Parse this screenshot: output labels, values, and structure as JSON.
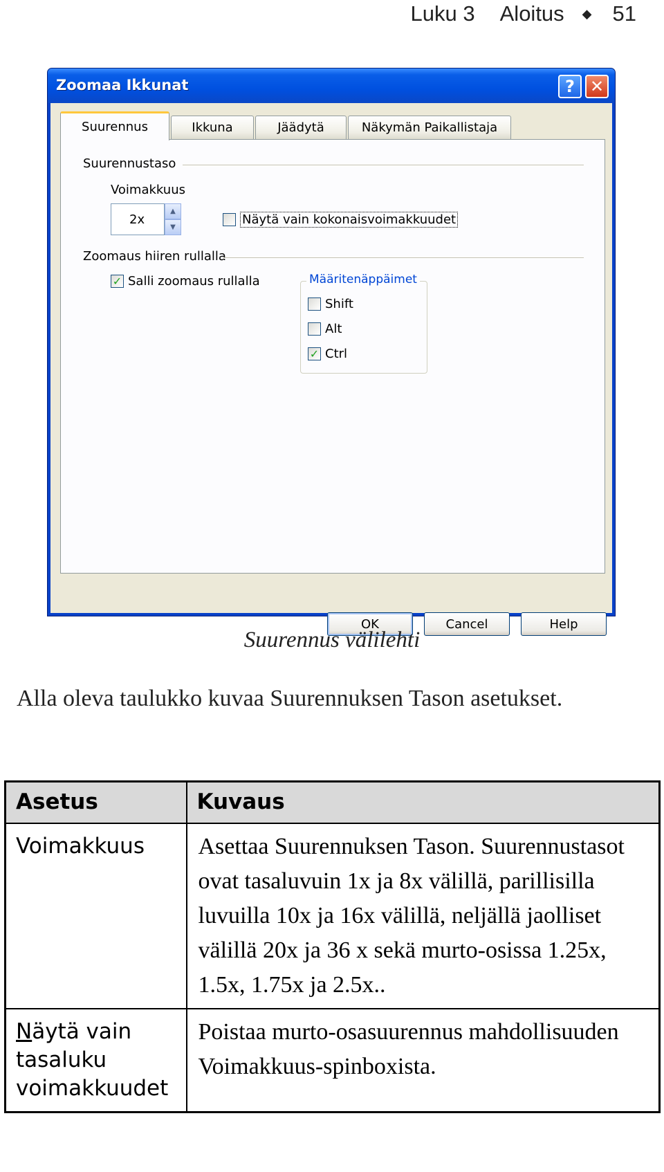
{
  "running_header": {
    "chapter": "Luku 3",
    "section": "Aloitus",
    "page_number": "51"
  },
  "dialog": {
    "title": "Zoomaa Ikkunat",
    "help_button": "?",
    "close_button": "✕",
    "tabs": [
      {
        "label": "Suurennus",
        "active": true
      },
      {
        "label": "Ikkuna",
        "active": false
      },
      {
        "label": "Jäädytä",
        "active": false
      },
      {
        "label": "Näkymän Paikallistaja",
        "active": false
      }
    ],
    "magnification_group": "Suurennustaso",
    "strength_label": "Voimakkuus",
    "strength_value": "2x",
    "integer_only_label": "Näytä vain kokonaisvoimakkuudet",
    "integer_only_checked": false,
    "wheel_group": "Zoomaus hiiren rullalla",
    "allow_wheel_label": "Salli zoomaus rullalla",
    "allow_wheel_checked": true,
    "modifier_group": "Määritenäppäimet",
    "modifiers": [
      {
        "label": "Shift",
        "checked": false
      },
      {
        "label": "Alt",
        "checked": false
      },
      {
        "label": "Ctrl",
        "checked": true
      }
    ],
    "buttons": {
      "ok": "OK",
      "cancel": "Cancel",
      "help": "Help"
    }
  },
  "caption": "Suurennus välilehti",
  "intro_paragraph": "Alla oleva taulukko kuvaa Suurennuksen Tason asetukset.",
  "table": {
    "headers": [
      "Asetus",
      "Kuvaus"
    ],
    "rows": [
      {
        "setting": "Voimakkuus",
        "description": "Asettaa Suurennuksen Tason. Suurennustasot ovat tasaluvuin 1x ja 8x välillä, parillisilla luvuilla 10x ja 16x välillä, neljällä jaolliset välillä 20x ja 36 x sekä murto-osissa 1.25x, 1.5x, 1.75x ja 2.5x.."
      },
      {
        "setting_first": "N",
        "setting_rest": "äytä vain tasaluku voimakkuudet",
        "description": "Poistaa murto-osasuurennus mahdollisuuden Voimakkuus-spinboxista."
      }
    ]
  }
}
